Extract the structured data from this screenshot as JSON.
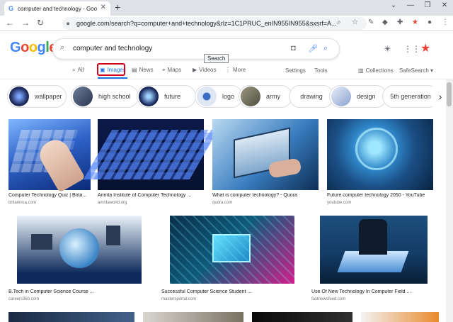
{
  "browser": {
    "tab_title": "computer and technology - Goo",
    "tab_favicon": "G",
    "url": "google.com/search?q=computer+and+technology&rlz=1C1PRUC_enIN955IN955&sxsrf=A..."
  },
  "search": {
    "query": "computer and technology",
    "tooltip": "Search"
  },
  "logo": {
    "letters": [
      "G",
      "o",
      "o",
      "g",
      "l",
      "e"
    ]
  },
  "nav_tabs": [
    {
      "label": "All",
      "icon": "search-icon"
    },
    {
      "label": "Images",
      "icon": "image-icon"
    },
    {
      "label": "News",
      "icon": "news-icon"
    },
    {
      "label": "Maps",
      "icon": "map-pin-icon"
    },
    {
      "label": "Videos",
      "icon": "play-icon"
    },
    {
      "label": "More",
      "icon": "more-vertical-icon"
    }
  ],
  "tools": {
    "settings_label": "Settings",
    "tools_label": "Tools",
    "collections_label": "Collections",
    "safesearch_label": "SafeSearch"
  },
  "chips": [
    {
      "label": "wallpaper",
      "color": "#1f2b5c"
    },
    {
      "label": "high school",
      "color": "#3a4a6a"
    },
    {
      "label": "future",
      "color": "#132055"
    },
    {
      "label": "logo",
      "color": "#dfe6f3"
    },
    {
      "label": "army",
      "color": "#6b6a5a"
    },
    {
      "label": "drawing",
      "color": ""
    },
    {
      "label": "design",
      "color": "#b9c6e0"
    },
    {
      "label": "5th generation",
      "color": ""
    }
  ],
  "results_row1": [
    {
      "title": "Computer Technology Quiz | Brita...",
      "source": "britannica.com",
      "color": "#2f63c8"
    },
    {
      "title": "Amrita Institute of Computer Technology ...",
      "source": "amritaworld.org",
      "color": "#0c1a4a"
    },
    {
      "title": "What is computer technology? - Quora",
      "source": "quora.com",
      "color": "#3a7dc0"
    },
    {
      "title": "Future computer technology 2050 - YouTube",
      "source": "youtube.com",
      "color": "#1b4f86"
    }
  ],
  "results_row2": [
    {
      "title": "B.Tech in Computer Science Course ...",
      "source": "careers360.com",
      "color": "#0d2a5a"
    },
    {
      "title": "Successful Computer Science Student ...",
      "source": "mastersportal.com",
      "color": "#0e5a7a"
    },
    {
      "title": "Use Of New Technology In Computer Field ...",
      "source": "fastnewsfeed.com",
      "color": "#123a64"
    }
  ]
}
